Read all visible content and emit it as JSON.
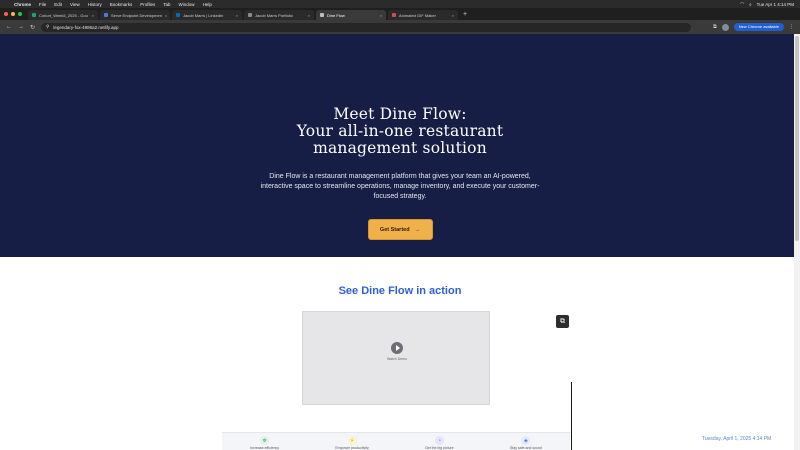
{
  "menubar": {
    "app": "Chrome",
    "items": [
      "File",
      "Edit",
      "View",
      "History",
      "Bookmarks",
      "Profiles",
      "Tab",
      "Window",
      "Help"
    ],
    "clock": "Tue Apr 1  4:14 PM"
  },
  "tabs": [
    {
      "label": "Cohort_Week5_2025 - Goo",
      "active": false
    },
    {
      "label": "Serve Endpoint Developmen",
      "active": false
    },
    {
      "label": "Jacob Marrs | LinkedIn",
      "active": false
    },
    {
      "label": "Jacob Marrs Portfolio",
      "active": false
    },
    {
      "label": "Dine Flow",
      "active": true
    },
    {
      "label": "Animated GIF Maker",
      "active": false
    }
  ],
  "browser": {
    "url": "legendary-fox-4986a2.netlify.app",
    "update_label": "New Chrome available"
  },
  "hero": {
    "title_line1": "Meet Dine Flow:",
    "title_line2": "Your all-in-one restaurant",
    "title_line3": "management solution",
    "description": "Dine Flow is a restaurant management platform that gives your team an AI-powered, interactive space to streamline operations, manage inventory, and execute your customer-focused strategy.",
    "cta_label": "Get Started",
    "cta_arrow": "→"
  },
  "demo": {
    "heading": "See Dine Flow in action",
    "video_caption": "Watch Demo",
    "features": [
      {
        "label": "Increase efficiency",
        "icon": "sparkle-icon",
        "color": "#dff3e4",
        "fg": "#2f9b57"
      },
      {
        "label": "Empower productivity",
        "icon": "bolt-icon",
        "color": "#fbf3c9",
        "fg": "#c49a0e"
      },
      {
        "label": "Get the big picture",
        "icon": "chart-icon",
        "color": "#e6e3fb",
        "fg": "#6a5acd"
      },
      {
        "label": "Stay safe and sound",
        "icon": "shield-icon",
        "color": "#e2ebfb",
        "fg": "#3b6fd8"
      }
    ],
    "timestamp": "Tuesday, April 1, 2025 4:14 PM"
  },
  "colors": {
    "hero_bg": "#161e45",
    "cta_bg": "#f0b14a",
    "heading_blue": "#2f5fd8"
  }
}
